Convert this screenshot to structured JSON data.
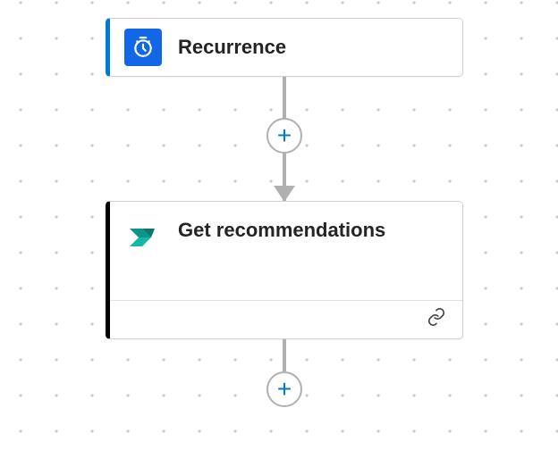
{
  "nodes": [
    {
      "title": "Recurrence",
      "icon": "clock-icon",
      "accent": "#0078d4",
      "icon_bg": "#1267e8"
    },
    {
      "title": "Get recommendations",
      "icon": "power-automate-icon",
      "accent": "#000000",
      "footer_icon": "link-icon"
    }
  ],
  "add_button_label": "+",
  "colors": {
    "azure_blue": "#0078d4",
    "connector": "#b0b0b0",
    "border": "#d1d1d1",
    "text": "#242424"
  }
}
